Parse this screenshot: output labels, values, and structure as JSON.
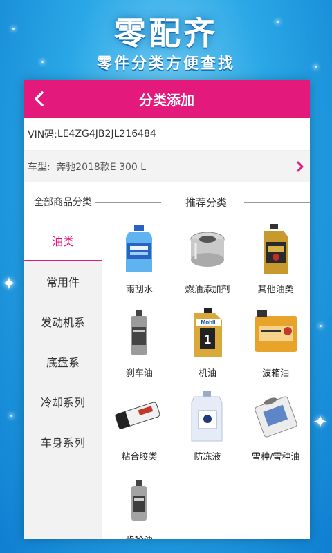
{
  "banner": {
    "title": "零配齐",
    "subtitle": "零件分类方便查找"
  },
  "app": {
    "title": "分类添加",
    "vin_label": "VIN码:",
    "vin_value": "LE4ZG4JB2JL216484",
    "car_label": "车型:",
    "car_value": "奔驰2018款E 300 L"
  },
  "left_panel": {
    "header": "全部商品分类",
    "items": [
      "油类",
      "常用件",
      "发动机系",
      "底盘系",
      "冷却系列",
      "车身系列"
    ],
    "active_index": 0
  },
  "right_panel": {
    "header": "推荐分类",
    "products": [
      {
        "label": "雨刮水",
        "icon": "washer-fluid-bottle"
      },
      {
        "label": "燃油添加剂",
        "icon": "fuel-filter-canister"
      },
      {
        "label": "其他油类",
        "icon": "oil-bottle-gold"
      },
      {
        "label": "刹车油",
        "icon": "brake-fluid-bottle"
      },
      {
        "label": "机油",
        "icon": "mobil-engine-oil"
      },
      {
        "label": "波箱油",
        "icon": "gearbox-oil-can"
      },
      {
        "label": "粘合胶类",
        "icon": "adhesive-tube"
      },
      {
        "label": "防冻液",
        "icon": "antifreeze-jug"
      },
      {
        "label": "雪种/雪种油",
        "icon": "refrigerant-can"
      },
      {
        "label": "齿轮油",
        "icon": "gear-oil-bottle"
      }
    ]
  },
  "colors": {
    "accent": "#e4197c",
    "background": "#2aa7e6"
  }
}
